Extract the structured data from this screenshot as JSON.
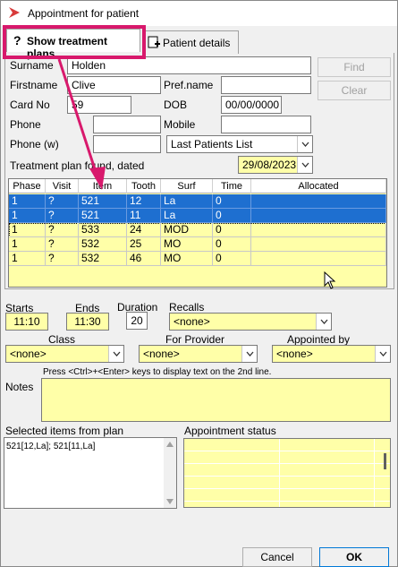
{
  "window": {
    "title": "Appointment for patient"
  },
  "tabs": [
    {
      "label": "Show treatment plans",
      "active": true
    },
    {
      "label": "Patient details",
      "active": false
    }
  ],
  "patient": {
    "surname_label": "Surname",
    "surname": "Holden",
    "firstname_label": "Firstname",
    "firstname": "Clive",
    "prefname_label": "Pref.name",
    "prefname": "",
    "cardno_label": "Card No",
    "cardno": "59",
    "dob_label": "DOB",
    "dob": "00/00/0000",
    "phone_label": "Phone",
    "phone": "",
    "mobile_label": "Mobile",
    "mobile": "",
    "phonew_label": "Phone (w)",
    "phonew": "",
    "last_patients": "Last Patients List"
  },
  "buttons": {
    "find": "Find",
    "clear": "Clear",
    "cancel": "Cancel",
    "ok": "OK"
  },
  "plan": {
    "found_label": "Treatment plan found, dated",
    "date": "29/08/2023"
  },
  "grid": {
    "columns": [
      "Phase",
      "Visit",
      "Item",
      "Tooth",
      "Surf",
      "Time",
      "Allocated"
    ],
    "rows": [
      {
        "phase": "1",
        "visit": "?",
        "item": "521",
        "tooth": "12",
        "surf": "La",
        "time": "0",
        "allocated": "",
        "selected": true
      },
      {
        "phase": "1",
        "visit": "?",
        "item": "521",
        "tooth": "11",
        "surf": "La",
        "time": "0",
        "allocated": "",
        "selected": true
      },
      {
        "phase": "1",
        "visit": "?",
        "item": "533",
        "tooth": "24",
        "surf": "MOD",
        "time": "0",
        "allocated": "",
        "selected": false
      },
      {
        "phase": "1",
        "visit": "?",
        "item": "532",
        "tooth": "25",
        "surf": "MO",
        "time": "0",
        "allocated": "",
        "selected": false
      },
      {
        "phase": "1",
        "visit": "?",
        "item": "532",
        "tooth": "46",
        "surf": "MO",
        "time": "0",
        "allocated": "",
        "selected": false
      }
    ]
  },
  "appointment": {
    "starts_label": "Starts",
    "starts": "11:10",
    "ends_label": "Ends",
    "ends": "11:30",
    "duration_label": "Duration",
    "duration": "20",
    "recalls_label": "Recalls",
    "recalls": "<none>",
    "class_label": "Class",
    "class": "<none>",
    "provider_label": "For Provider",
    "provider": "<none>",
    "appointed_label": "Appointed by",
    "appointed": "<none>",
    "hint": "Press <Ctrl>+<Enter> keys to display text on the 2nd line.",
    "notes_label": "Notes",
    "selected_items_label": "Selected items from plan",
    "selected_items": "521[12,La]; 521[11,La]",
    "status_label": "Appointment status"
  },
  "colors": {
    "highlight": "#d8196c",
    "selection": "#1e6fd0",
    "field_yellow": "#ffffa8"
  }
}
